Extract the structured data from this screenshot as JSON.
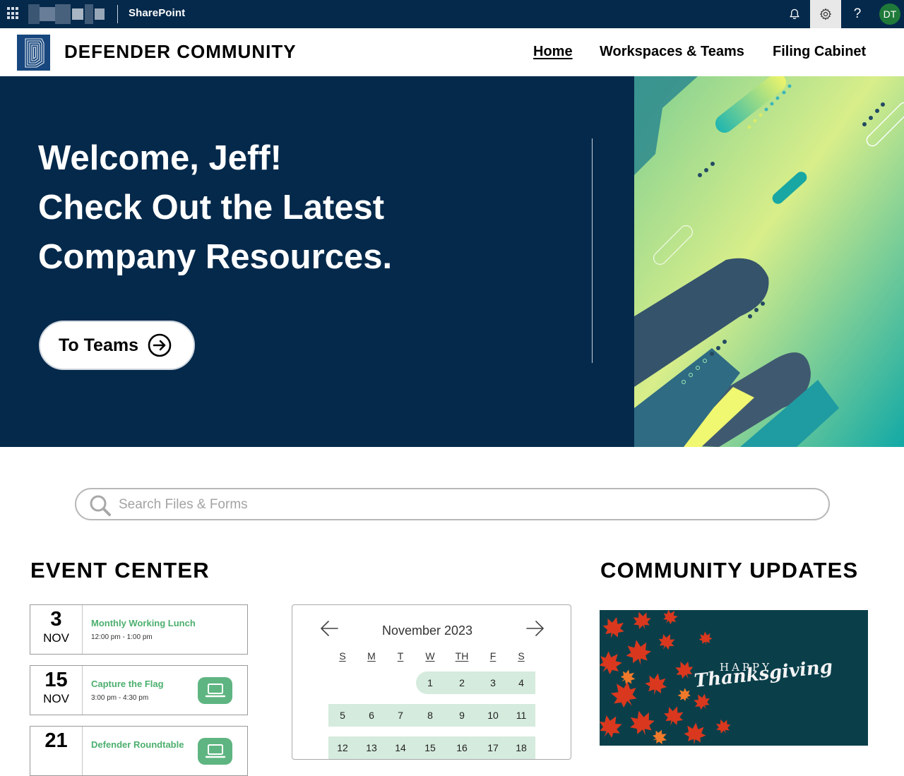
{
  "suitebar": {
    "app_name": "SharePoint",
    "avatar_initials": "DT",
    "help_glyph": "?",
    "icons": [
      "waffle-icon",
      "bell-icon",
      "gear-icon",
      "help-icon"
    ]
  },
  "site": {
    "name": "DEFENDER COMMUNITY",
    "nav": [
      {
        "label": "Home",
        "active": true
      },
      {
        "label": "Workspaces & Teams",
        "active": false
      },
      {
        "label": "Filing Cabinet",
        "active": false
      }
    ]
  },
  "hero": {
    "lines": [
      "Welcome, Jeff!",
      "Check Out the Latest",
      "Company Resources."
    ],
    "button_label": "To Teams",
    "background_color": "#04294b"
  },
  "search": {
    "placeholder": "Search Files & Forms",
    "value": ""
  },
  "events": {
    "heading": "EVENT CENTER",
    "items": [
      {
        "day": "3",
        "month": "NOV",
        "title": "Monthly Working Lunch",
        "time": "12:00 pm - 1:00 pm",
        "badge_icon": ""
      },
      {
        "day": "15",
        "month": "NOV",
        "title": "Capture the Flag",
        "time": "3:00 pm - 4:30 pm",
        "badge_icon": "laptop-icon"
      },
      {
        "day": "21",
        "month": "",
        "title": "Defender Roundtable",
        "time": "",
        "badge_icon": "laptop-icon"
      }
    ],
    "accent_color": "#4caf6e"
  },
  "calendar": {
    "title": "November 2023",
    "weekdays": [
      "S",
      "M",
      "T",
      "W",
      "TH",
      "F",
      "S"
    ],
    "weeks": [
      [
        "",
        "",
        "",
        "1",
        "2",
        "3",
        "4"
      ],
      [
        "5",
        "6",
        "7",
        "8",
        "9",
        "10",
        "11"
      ],
      [
        "12",
        "13",
        "14",
        "15",
        "16",
        "17",
        "18"
      ]
    ],
    "highlight_color": "#d5ebdd"
  },
  "updates": {
    "heading": "COMMUNITY UPDATES",
    "card_line1": "HAPPY",
    "card_line2": "Thanksgiving"
  }
}
